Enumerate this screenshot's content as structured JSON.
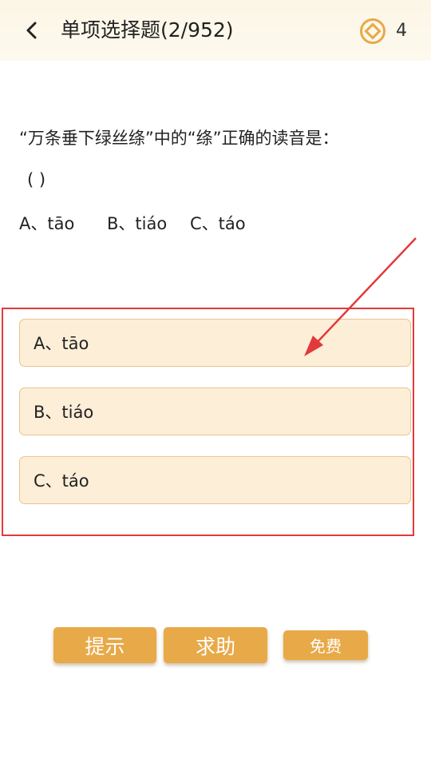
{
  "header": {
    "title": "单项选择题(2/952)",
    "coins": "4"
  },
  "question": {
    "text": "“万条垂下绿丝绦”中的“绦”正确的读音是：",
    "blank": "( )",
    "choices_inline": [
      "A、tāo",
      "B、tiáo",
      "C、táo"
    ]
  },
  "options": [
    {
      "label": "A、tāo"
    },
    {
      "label": "B、tiáo"
    },
    {
      "label": "C、táo"
    }
  ],
  "buttons": {
    "hint": "提示",
    "help": "求助",
    "free": "免费"
  },
  "colors": {
    "accent": "#e8a948",
    "option_bg": "#fdeed8",
    "highlight": "#e23a3a",
    "header_bg": "#fbf6e6"
  }
}
